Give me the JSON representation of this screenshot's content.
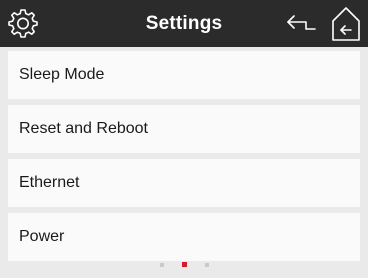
{
  "header": {
    "title": "Settings",
    "left_icon": "gear-icon",
    "back_icon": "back-arrow-icon",
    "home_icon": "home-icon"
  },
  "menu": {
    "items": [
      {
        "label": "Sleep Mode"
      },
      {
        "label": "Reset and Reboot"
      },
      {
        "label": "Ethernet"
      },
      {
        "label": "Power"
      }
    ]
  },
  "pager": {
    "total_pages": 3,
    "current_page": 2
  },
  "colors": {
    "header_bg": "#2b2b2b",
    "page_bg": "#eaeaea",
    "item_bg": "#fafafa",
    "accent": "#d7192c"
  }
}
